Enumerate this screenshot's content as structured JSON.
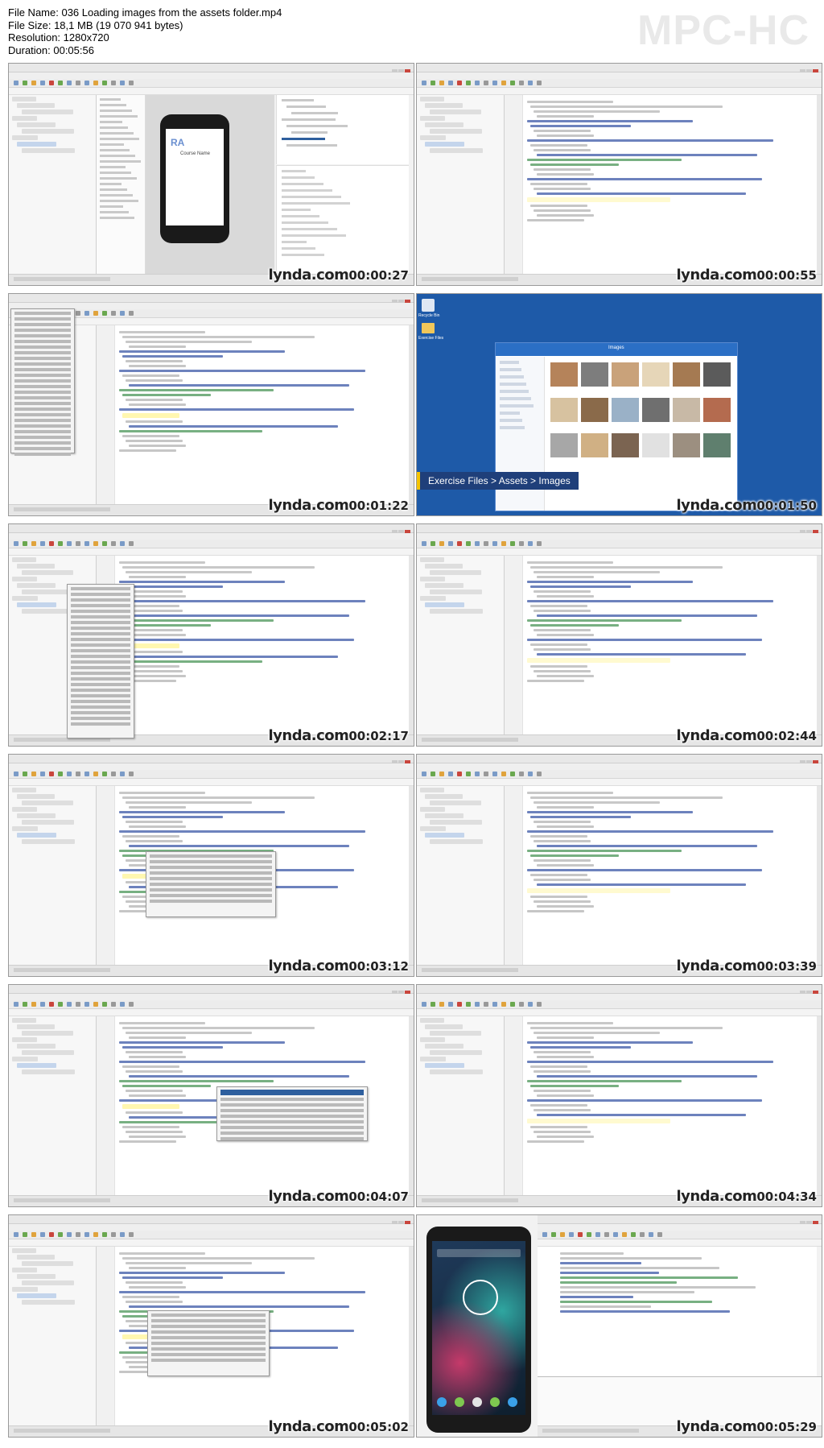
{
  "header": {
    "file_name": "File Name: 036 Loading images from the assets folder.mp4",
    "file_size": "File Size: 18,1 MB (19 070 941 bytes)",
    "resolution": "Resolution: 1280x720",
    "duration": "Duration: 00:05:56"
  },
  "brand": "MPC-HC",
  "watermark": "lynda.com",
  "thumbnails": [
    {
      "time": "00:00:27",
      "scene": "layout-designer"
    },
    {
      "time": "00:00:55",
      "scene": "code-editor"
    },
    {
      "time": "00:01:22",
      "scene": "file-menu"
    },
    {
      "time": "00:01:50",
      "scene": "windows-explorer"
    },
    {
      "time": "00:02:17",
      "scene": "context-menu"
    },
    {
      "time": "00:02:44",
      "scene": "code-editor"
    },
    {
      "time": "00:03:12",
      "scene": "autocomplete"
    },
    {
      "time": "00:03:39",
      "scene": "code-editor"
    },
    {
      "time": "00:04:07",
      "scene": "autocomplete"
    },
    {
      "time": "00:04:34",
      "scene": "code-editor"
    },
    {
      "time": "00:05:02",
      "scene": "autocomplete"
    },
    {
      "time": "00:05:29",
      "scene": "emulator"
    }
  ],
  "screens": {
    "designer_app_title": "Course Name",
    "designer_app_logo": "RA",
    "explorer_title": "Images",
    "explorer_banner": "Exercise Files > Assets > Images",
    "desktop_icon_1": "Recycle Bin",
    "desktop_icon_2": "Exercise Files"
  },
  "colors": {
    "accent_blue": "#2e5f9e",
    "desktop_blue": "#1e5aa8",
    "banner_yellow": "#f5c400",
    "close_red": "#c9463d"
  }
}
